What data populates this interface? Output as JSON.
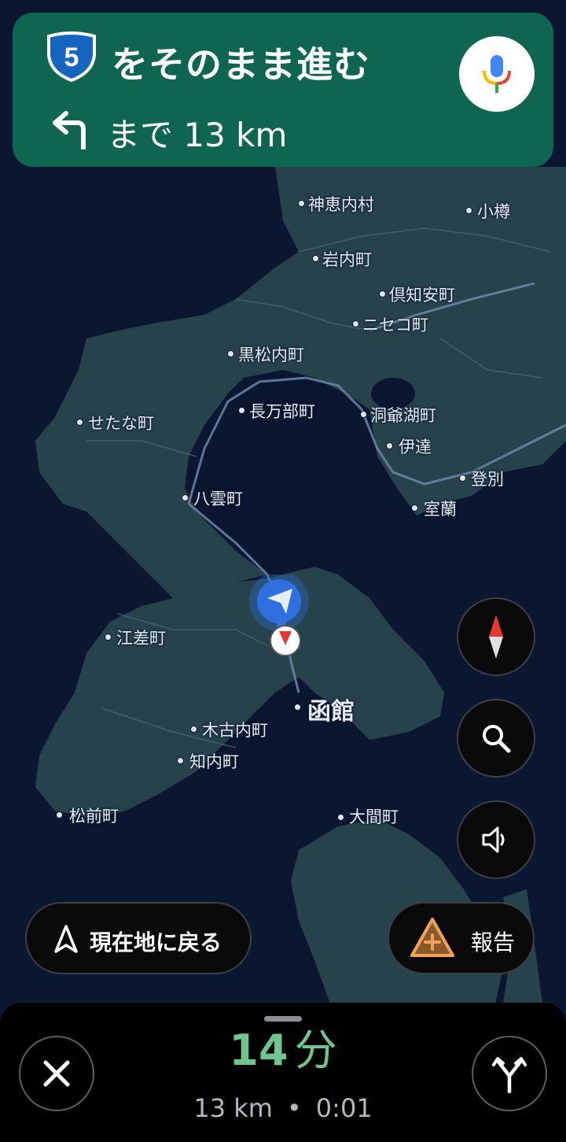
{
  "banner": {
    "route_number": "5",
    "instruction": "をそのまま進む",
    "then_text": "まで 13 km",
    "turn_icon": "turn-left-arrow-icon",
    "mic_icon": "google-mic-icon"
  },
  "map": {
    "labels": {
      "kamoenai": "神恵内村",
      "otaru": "小樽",
      "iwanai": "岩内町",
      "kutchan": "倶知安町",
      "niseko": "ニセコ町",
      "kuromatsunai": "黒松内町",
      "oshamambe": "長万部町",
      "toyako": "洞爺湖町",
      "setana": "せたな町",
      "date": "伊達",
      "noboribetsu": "登別",
      "muroran": "室蘭",
      "yakumo": "八雲町",
      "esashi": "江差町",
      "hakodate": "函館",
      "kikonai": "木古内町",
      "shiriuchi": "知内町",
      "matsumae": "松前町",
      "oma": "大間町"
    }
  },
  "controls": {
    "compass_icon": "compass-icon",
    "search_icon": "search-icon",
    "sound_icon": "speaker-icon",
    "recenter_label": "現在地に戻る",
    "report_label": "報告"
  },
  "bottom": {
    "eta_value": "14",
    "eta_unit": "分",
    "distance": "13 km",
    "separator": "•",
    "arrival_time": "0:01"
  },
  "colors": {
    "banner": "#0f6650",
    "map_water": "#0b1730",
    "map_land": "#26434c",
    "eta_green": "#72c48f",
    "report_orange": "#f0a25a",
    "location_blue": "#2f6fe0"
  }
}
